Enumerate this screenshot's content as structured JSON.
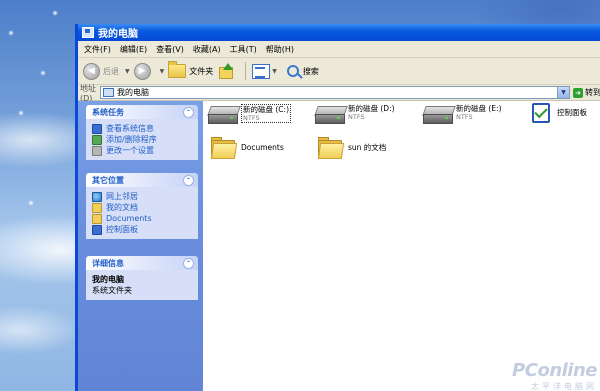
{
  "window": {
    "title": "我的电脑"
  },
  "menu": [
    "文件(F)",
    "编辑(E)",
    "查看(V)",
    "收藏(A)",
    "工具(T)",
    "帮助(H)"
  ],
  "toolbar": {
    "back_label": "后退",
    "folders_label": "文件夹",
    "search_label": "搜索"
  },
  "address": {
    "label": "地址(D)",
    "value": "我的电脑",
    "go_label": "转到"
  },
  "taskpane": {
    "system_tasks": {
      "title": "系统任务",
      "items": [
        "查看系统信息",
        "添加/删除程序",
        "更改一个设置"
      ]
    },
    "other_places": {
      "title": "其它位置",
      "items": [
        "网上邻居",
        "我的文档",
        "Documents",
        "控制面板"
      ]
    },
    "details": {
      "title": "详细信息",
      "name": "我的电脑",
      "type": "系统文件夹"
    }
  },
  "content": {
    "drives": [
      {
        "label": "新的磁盘 (C:)",
        "fs": "NTFS"
      },
      {
        "label": "新的磁盘 (D:)",
        "fs": "NTFS"
      },
      {
        "label": "新的磁盘 (E:)",
        "fs": "NTFS"
      }
    ],
    "control_panel": "控制面板",
    "folders": [
      "Documents",
      "sun 的文档"
    ]
  },
  "watermark": {
    "brand": "PConline",
    "sub": "太平洋电脑网"
  },
  "colors": {
    "title_bar": "#0549d6",
    "task_pane": "#6b8fdd",
    "link": "#215dc6"
  }
}
